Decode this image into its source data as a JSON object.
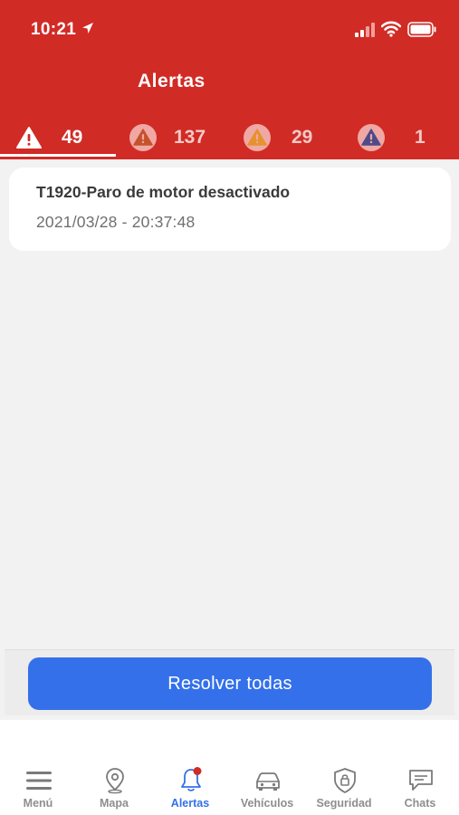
{
  "status_bar": {
    "time": "10:21"
  },
  "header": {
    "title": "Alertas"
  },
  "tabs": [
    {
      "count": "49",
      "icon": "warning-white-icon",
      "color": "#ffffff",
      "active": true
    },
    {
      "count": "137",
      "icon": "warning-red-icon",
      "color": "#c5522b"
    },
    {
      "count": "29",
      "icon": "warning-orange-icon",
      "color": "#e5922f"
    },
    {
      "count": "1",
      "icon": "warning-purple-icon",
      "color": "#4f4a8a"
    }
  ],
  "alerts": [
    {
      "title": "T1920-Paro de motor desactivado",
      "datetime": "2021/03/28 - 20:37:48"
    }
  ],
  "actions": {
    "resolve_all": "Resolver todas"
  },
  "bottom_nav": [
    {
      "label": "Menú",
      "icon": "menu-icon"
    },
    {
      "label": "Mapa",
      "icon": "map-pin-icon"
    },
    {
      "label": "Alertas",
      "icon": "bell-icon",
      "active": true
    },
    {
      "label": "Vehículos",
      "icon": "car-icon"
    },
    {
      "label": "Seguridad",
      "icon": "shield-icon"
    },
    {
      "label": "Chats",
      "icon": "chat-icon"
    }
  ],
  "colors": {
    "header_red": "#d12b25",
    "primary_blue": "#3470ea",
    "badge_red": "#d12b25"
  }
}
